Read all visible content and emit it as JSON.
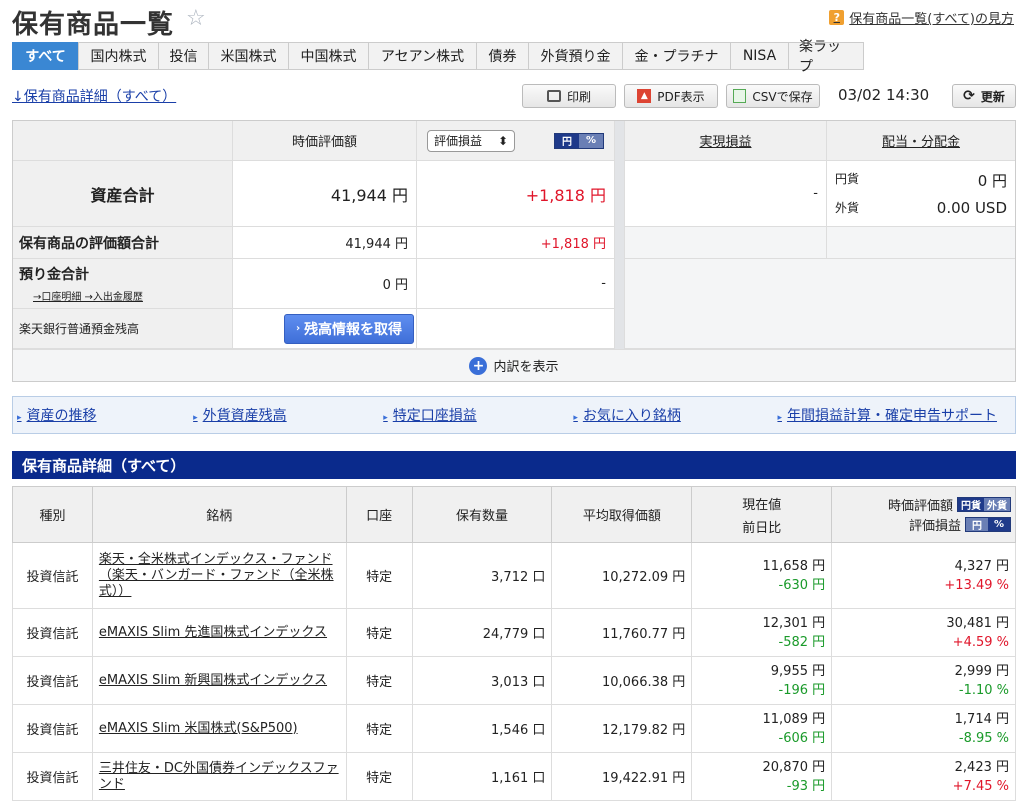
{
  "header": {
    "title": "保有商品一覧",
    "help_link": "保有商品一覧(すべて)の見方"
  },
  "tabs": [
    "すべて",
    "国内株式",
    "投信",
    "米国株式",
    "中国株式",
    "アセアン株式",
    "債券",
    "外貨預り金",
    "金・プラチナ",
    "NISA",
    "楽ラップ"
  ],
  "toolbar": {
    "detail_link": "↓保有商品詳細（すべて）",
    "print": "印刷",
    "pdf": "PDF表示",
    "csv": "CSVで保存",
    "timestamp": "03/02 14:30",
    "refresh": "更新"
  },
  "summary": {
    "col_value": "時価評価額",
    "select_value": "評価損益",
    "toggle_yen": "円",
    "toggle_pct": "%",
    "col_realized": "実現損益",
    "col_dividend": "配当・分配金",
    "total_label": "資産合計",
    "total_value": "41,944 円",
    "total_pl": "+1,818 円",
    "realized_value": "-",
    "div_yen_label": "円貨",
    "div_yen_value": "0 円",
    "div_fx_label": "外貨",
    "div_fx_value": "0.00 USD",
    "holdings_label": "保有商品の評価額合計",
    "holdings_value": "41,944 円",
    "holdings_pl": "+1,818 円",
    "deposit_label": "預り金合計",
    "deposit_links": "→口座明細 →入出金履歴",
    "deposit_value": "0 円",
    "deposit_pl": "-",
    "bank_label": "楽天銀行普通預金残高",
    "bank_button": "残高情報を取得",
    "expand": "内訳を表示"
  },
  "quick_links": [
    "資産の推移",
    "外貨資産残高",
    "特定口座損益",
    "お気に入り銘柄",
    "年間損益計算・確定申告サポート"
  ],
  "section_title": "保有商品詳細（すべて）",
  "table": {
    "headers": {
      "type": "種別",
      "name": "銘柄",
      "account": "口座",
      "qty": "保有数量",
      "avg": "平均取得価額",
      "price": "現在値",
      "change": "前日比",
      "mv": "時価評価額",
      "pl": "評価損益",
      "t_yen": "円貨",
      "t_fx": "外貨",
      "t_y": "円",
      "t_p": "%"
    },
    "rows": [
      {
        "type": "投資信託",
        "name": "楽天・全米株式インデックス・ファンド（楽天・バンガード・ファンド（全米株式））",
        "account": "特定",
        "qty": "3,712 口",
        "avg": "10,272.09 円",
        "price": "11,658 円",
        "change": "-630 円",
        "mv": "4,327 円",
        "pl": "+13.49 %"
      },
      {
        "type": "投資信託",
        "name": "eMAXIS Slim 先進国株式インデックス",
        "account": "特定",
        "qty": "24,779 口",
        "avg": "11,760.77 円",
        "price": "12,301 円",
        "change": "-582 円",
        "mv": "30,481 円",
        "pl": "+4.59 %"
      },
      {
        "type": "投資信託",
        "name": "eMAXIS Slim 新興国株式インデックス",
        "account": "特定",
        "qty": "3,013 口",
        "avg": "10,066.38 円",
        "price": "9,955 円",
        "change": "-196 円",
        "mv": "2,999 円",
        "pl": "-1.10 %"
      },
      {
        "type": "投資信託",
        "name": "eMAXIS Slim 米国株式(S&P500)",
        "account": "特定",
        "qty": "1,546 口",
        "avg": "12,179.82 円",
        "price": "11,089 円",
        "change": "-606 円",
        "mv": "1,714 円",
        "pl": "-8.95 %"
      },
      {
        "type": "投資信託",
        "name": "三井住友・DC外国債券インデックスファンド",
        "account": "特定",
        "qty": "1,161 口",
        "avg": "19,422.91 円",
        "price": "20,870 円",
        "change": "-93 円",
        "mv": "2,423 円",
        "pl": "+7.45 %"
      }
    ]
  }
}
